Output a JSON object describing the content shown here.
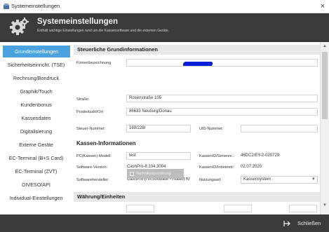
{
  "window": {
    "title": "Systemeinstellungen",
    "close_glyph": "×"
  },
  "header": {
    "title": "Systemeinstellungen",
    "subtitle": "Enthält wichtige Einstellungen rund um die Kassensoftware und die externen Geräte."
  },
  "sidebar": {
    "items": [
      {
        "label": "Grundeinstellungen",
        "active": true
      },
      {
        "label": "Sicherheitseinricht. (TSE)"
      },
      {
        "label": "Rechnung/Bondruck"
      },
      {
        "label": "Graphik/Touch"
      },
      {
        "label": "Kundenbonus"
      },
      {
        "label": "Kassendaten"
      },
      {
        "label": "Digitalisierung"
      },
      {
        "label": "Externe Geräte"
      },
      {
        "label": "EC-Terminal (B+S Card)"
      },
      {
        "label": "EC-Terminal (ZVT)"
      },
      {
        "label": "DIVESO/API"
      },
      {
        "label": "Individual-Einstellungen"
      }
    ]
  },
  "tax": {
    "heading": "Steuerliche Grundinformationen",
    "company_label": "Firmenbezeichnung",
    "street_label": "Straße:",
    "street_value": "Rosenstraße 105",
    "city_label": "Postleitzahl/Ort",
    "city_value": "86633 Neuburg/Donau",
    "taxno_label": "Steuer-Nummer:",
    "taxno_value": "169/228/",
    "vat_label": "UID-Nummer:",
    "vat_value": ""
  },
  "register": {
    "heading": "Kassen-Informationen",
    "model_label": "PC(Kassen)-Modell:",
    "model_value": "test",
    "serial_label": "KassenID/Seriennr.:",
    "serial_value": "46DC2/EY-2-020729",
    "version_label": "Software-Version:",
    "version_value": "CashPro-8.104.3004",
    "start_label": "KassenID/Inbetrieb:",
    "start_value": "02.07.2020",
    "maker_label": "Softwarehersteller:",
    "maker_value": "CashPro (HKSoftware - Hubert Kr",
    "usage_label": "Nutzungsart:",
    "usage_value": "Kassensystem",
    "tech_button": "Technikerzuordnung"
  },
  "currency": {
    "heading": "Währung/Einheiten"
  },
  "footer": {
    "close_label": "Schließen"
  },
  "colors": {
    "accent": "#4aa3df",
    "dark": "#3b3b3b",
    "redaction": "#0a1fd8"
  }
}
